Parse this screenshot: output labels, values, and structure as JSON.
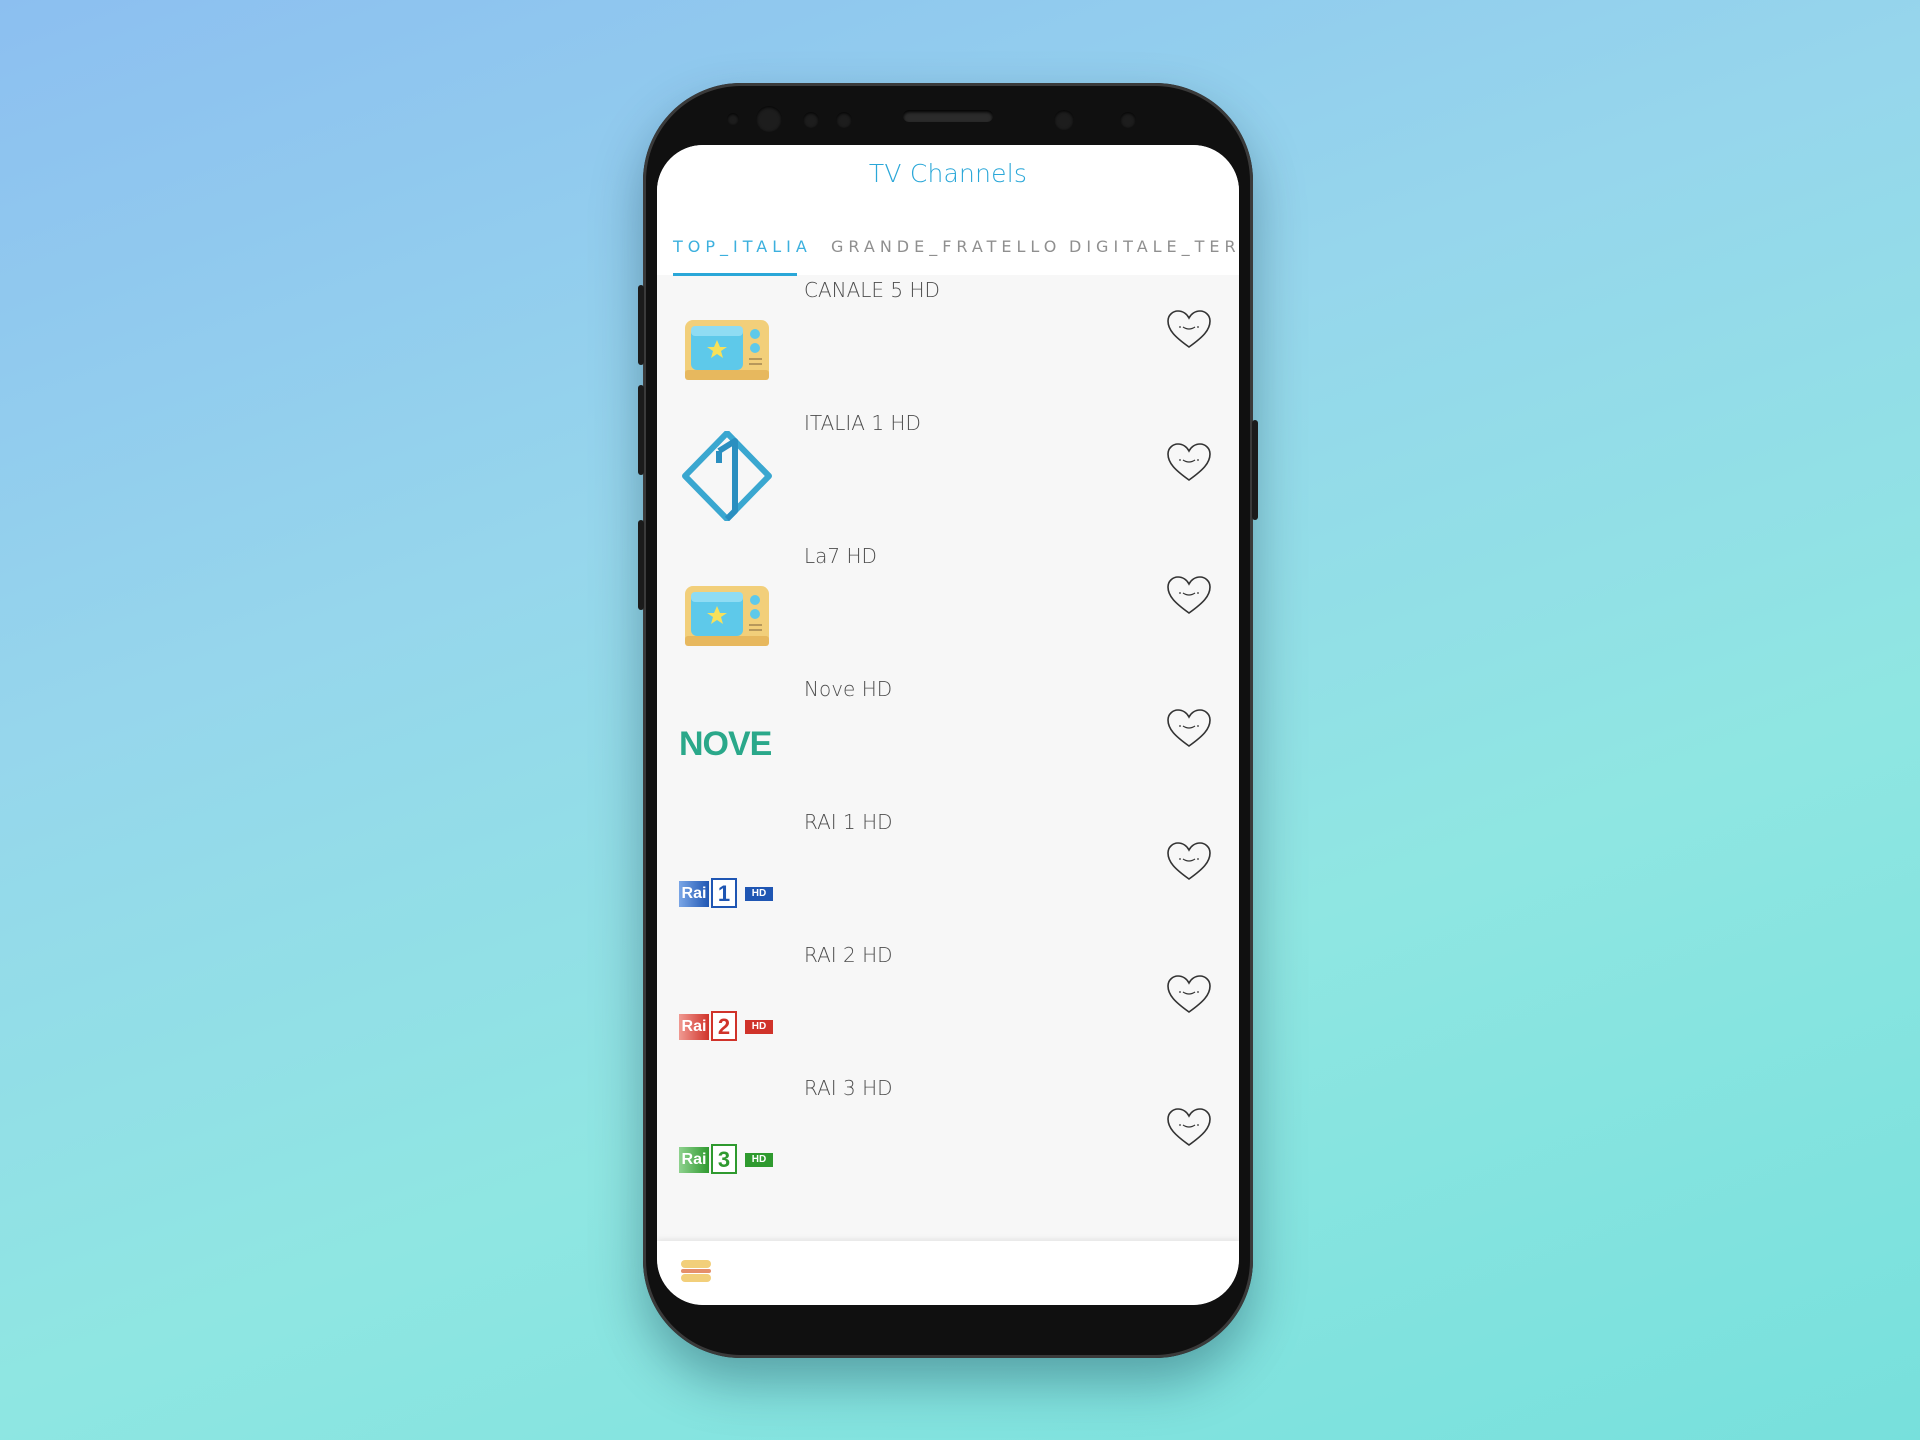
{
  "app": {
    "title": "TV Channels"
  },
  "tabs": [
    {
      "label": "TOP_ITALIA",
      "active": true
    },
    {
      "label": "GRANDE_FRATELLO",
      "active": false
    },
    {
      "label": "DIGITALE_TERR",
      "active": false
    }
  ],
  "channels": [
    {
      "name": "CANALE 5 HD",
      "logo": "tv-cartoon-icon"
    },
    {
      "name": "ITALIA 1 HD",
      "logo": "italia1-logo"
    },
    {
      "name": "La7 HD",
      "logo": "tv-cartoon-icon"
    },
    {
      "name": "Nove HD",
      "logo": "nove-logo",
      "logo_text": "NOVE"
    },
    {
      "name": "RAI 1 HD",
      "logo": "rai1-logo",
      "logo_text": "Rai",
      "logo_number": "1",
      "logo_badge": "HD"
    },
    {
      "name": "RAI 2 HD",
      "logo": "rai2-logo",
      "logo_text": "Rai",
      "logo_number": "2",
      "logo_badge": "HD"
    },
    {
      "name": "RAI 3 HD",
      "logo": "rai3-logo",
      "logo_text": "Rai",
      "logo_number": "3",
      "logo_badge": "HD"
    }
  ],
  "bottom_bar": {
    "icon": "menu-icon"
  },
  "colors": {
    "accent": "#2aa7d8",
    "rai1": "#1f56b3",
    "rai2": "#d0332a",
    "rai3": "#2f9a2f",
    "nove": "#2aa88a"
  }
}
